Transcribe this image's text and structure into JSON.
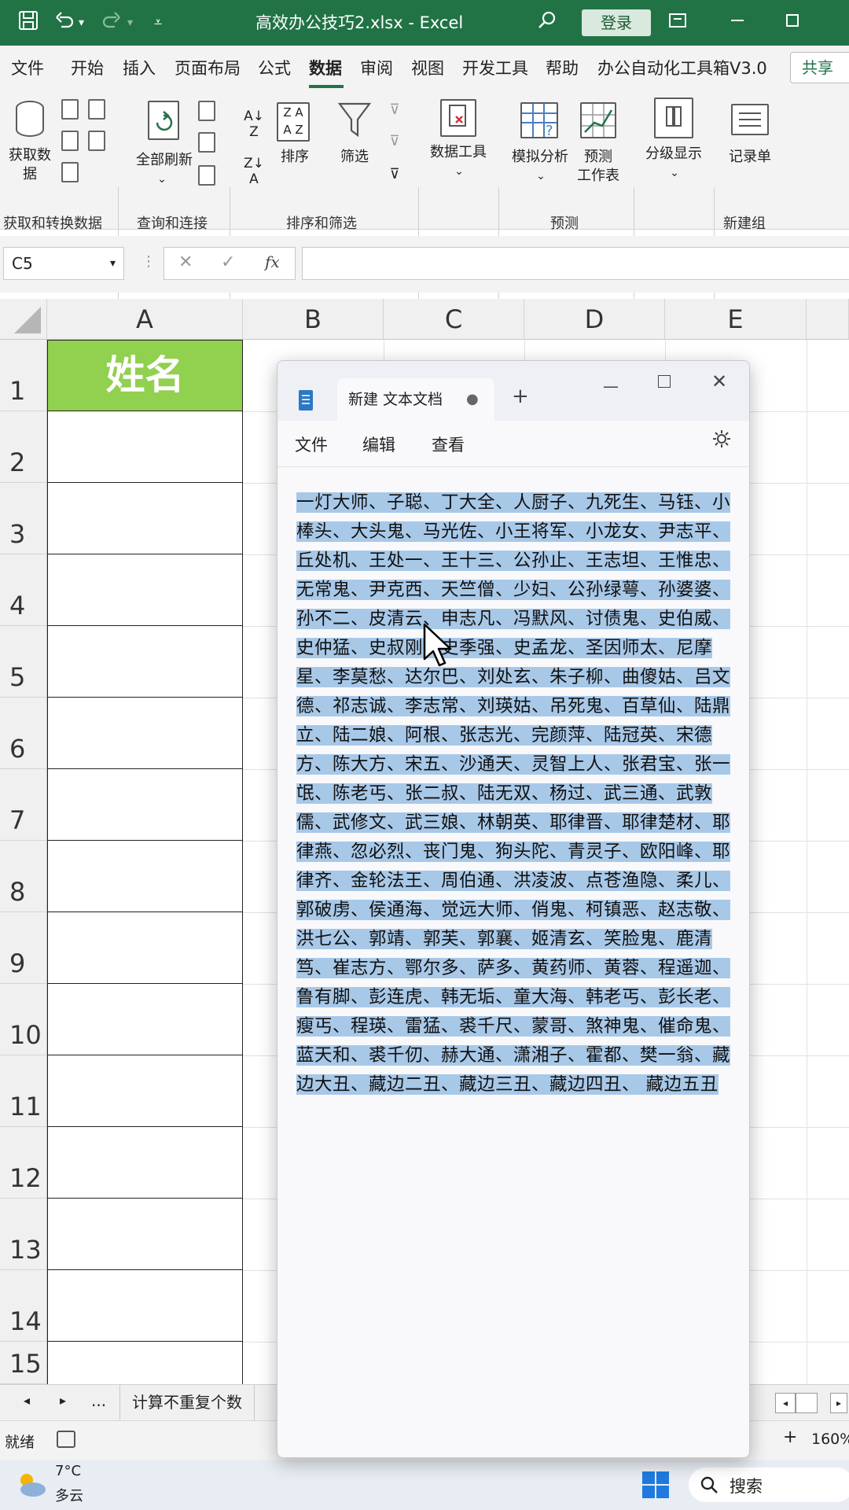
{
  "titlebar": {
    "title": "高效办公技巧2.xlsx  -  Excel",
    "login_label": "登录",
    "accent": "#217346"
  },
  "menu": {
    "items": [
      "文件",
      "开始",
      "插入",
      "页面布局",
      "公式",
      "数据",
      "审阅",
      "视图",
      "开发工具",
      "帮助",
      "办公自动化工具箱V3.0"
    ],
    "active": "数据",
    "share_label": "共享"
  },
  "ribbon": {
    "get_data_label": "获取数",
    "get_data_label2": "据",
    "refresh_all_label": "全部刷新",
    "sort_label": "排序",
    "filter_label": "筛选",
    "data_tools_label": "数据工具",
    "what_if_label": "模拟分析",
    "forecast_label": "预测",
    "forecast_label2": "工作表",
    "outline_label": "分级显示",
    "form_label": "记录单",
    "groups": {
      "get_transform": "获取和转换数据",
      "query_connect": "查询和连接",
      "sort_filter": "排序和筛选",
      "forecast": "预测",
      "new_group": "新建组"
    }
  },
  "formula_bar": {
    "name_box": "C5",
    "cancel_icon": "✕",
    "enter_icon": "✓",
    "fx_label": "fx",
    "formula": ""
  },
  "grid": {
    "columns": [
      "A",
      "B",
      "C",
      "D",
      "E"
    ],
    "rows": [
      "1",
      "2",
      "3",
      "4",
      "5",
      "6",
      "7",
      "8",
      "9",
      "10",
      "11",
      "12",
      "13",
      "14",
      "15"
    ],
    "header_cell": "姓名",
    "header_fill": "#92d050"
  },
  "notepad": {
    "tab_title": "新建 文本文档",
    "menu": [
      "文件",
      "编辑",
      "查看"
    ],
    "lines": [
      "一灯大师、子聪、丁大全、人厨子、九死生、马钰、小",
      "棒头、大头鬼、马光佐、小王将军、小龙女、尹志平、",
      "丘处机、王处一、王十三、公孙止、王志坦、王惟忠、",
      "无常鬼、尹克西、天竺僧、少妇、公孙绿萼、孙婆婆、",
      "孙不二、皮清云、申志凡、冯默风、讨债鬼、史伯威、",
      "史仲猛、史叔刚、史季强、史孟龙、圣因师太、尼摩",
      "星、李莫愁、达尔巴、刘处玄、朱子柳、曲傻姑、吕文",
      "德、祁志诚、李志常、刘瑛姑、吊死鬼、百草仙、陆鼎",
      "立、陆二娘、阿根、张志光、完颜萍、陆冠英、宋德",
      "方、陈大方、宋五、沙通天、灵智上人、张君宝、张一",
      "氓、陈老丐、张二叔、陆无双、杨过、武三通、武敦",
      "儒、武修文、武三娘、林朝英、耶律晋、耶律楚材、耶",
      "律燕、忽必烈、丧门鬼、狗头陀、青灵子、欧阳峰、耶",
      "律齐、金轮法王、周伯通、洪凌波、点苍渔隐、柔儿、",
      "郭破虏、侯通海、觉远大师、俏鬼、柯镇恶、赵志敬、",
      "洪七公、郭靖、郭芙、郭襄、姬清玄、笑脸鬼、鹿清",
      "笃、崔志方、鄂尔多、萨多、黄药师、黄蓉、程遥迦、",
      "鲁有脚、彭连虎、韩无垢、童大海、韩老丐、彭长老、",
      "瘦丐、程瑛、雷猛、裘千尺、蒙哥、煞神鬼、催命鬼、",
      "蓝天和、裘千仞、赫大通、潇湘子、霍都、樊一翁、藏",
      "边大丑、藏边二丑、藏边三丑、藏边四丑、 藏边五丑"
    ],
    "selection_color": "#a8c8e8"
  },
  "sheet_tabs": {
    "more_label": "...",
    "active_tab": "计算不重复个数"
  },
  "status": {
    "ready": "就绪",
    "zoom": "160%"
  },
  "taskbar": {
    "temperature": "7°C",
    "weather": "多云",
    "search_label": "搜索"
  }
}
